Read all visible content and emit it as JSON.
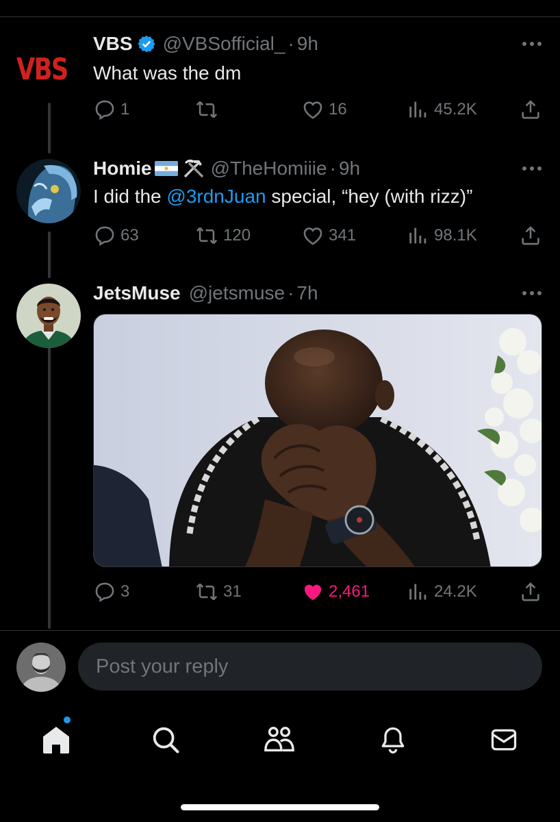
{
  "tweets": [
    {
      "name": "VBS",
      "handle": "@VBSofficial_",
      "separator": "·",
      "time": "9h",
      "avatar_text": "VBS",
      "text_parts": [
        "What was the dm"
      ],
      "replies": "1",
      "reposts": "",
      "likes": "16",
      "views": "45.2K"
    },
    {
      "name": "Homie",
      "name_suffix_icons": [
        "argentina-flag-icon",
        "hammer-pick-icon"
      ],
      "handle": "@TheHomiiie",
      "separator": "·",
      "time": "9h",
      "text_before": "I did the ",
      "mention": "@3rdnJuan",
      "text_after": " special, “hey (with rizz)”",
      "replies": "63",
      "reposts": "120",
      "likes": "341",
      "views": "98.1K"
    },
    {
      "name": "JetsMuse",
      "handle": "@jetsmuse",
      "separator": "·",
      "time": "7h",
      "replies": "3",
      "reposts": "31",
      "likes": "2,461",
      "liked": true,
      "views": "24.2K"
    }
  ],
  "reply": {
    "placeholder": "Post your reply"
  },
  "tabs": [
    "home-icon",
    "search-icon",
    "communities-icon",
    "notifications-icon",
    "messages-icon"
  ],
  "colors": {
    "background": "#000000",
    "text": "#e7e9ea",
    "muted": "#71767b",
    "accent": "#1d9bf0",
    "like": "#f91880",
    "vbs_red": "#d0221c"
  }
}
